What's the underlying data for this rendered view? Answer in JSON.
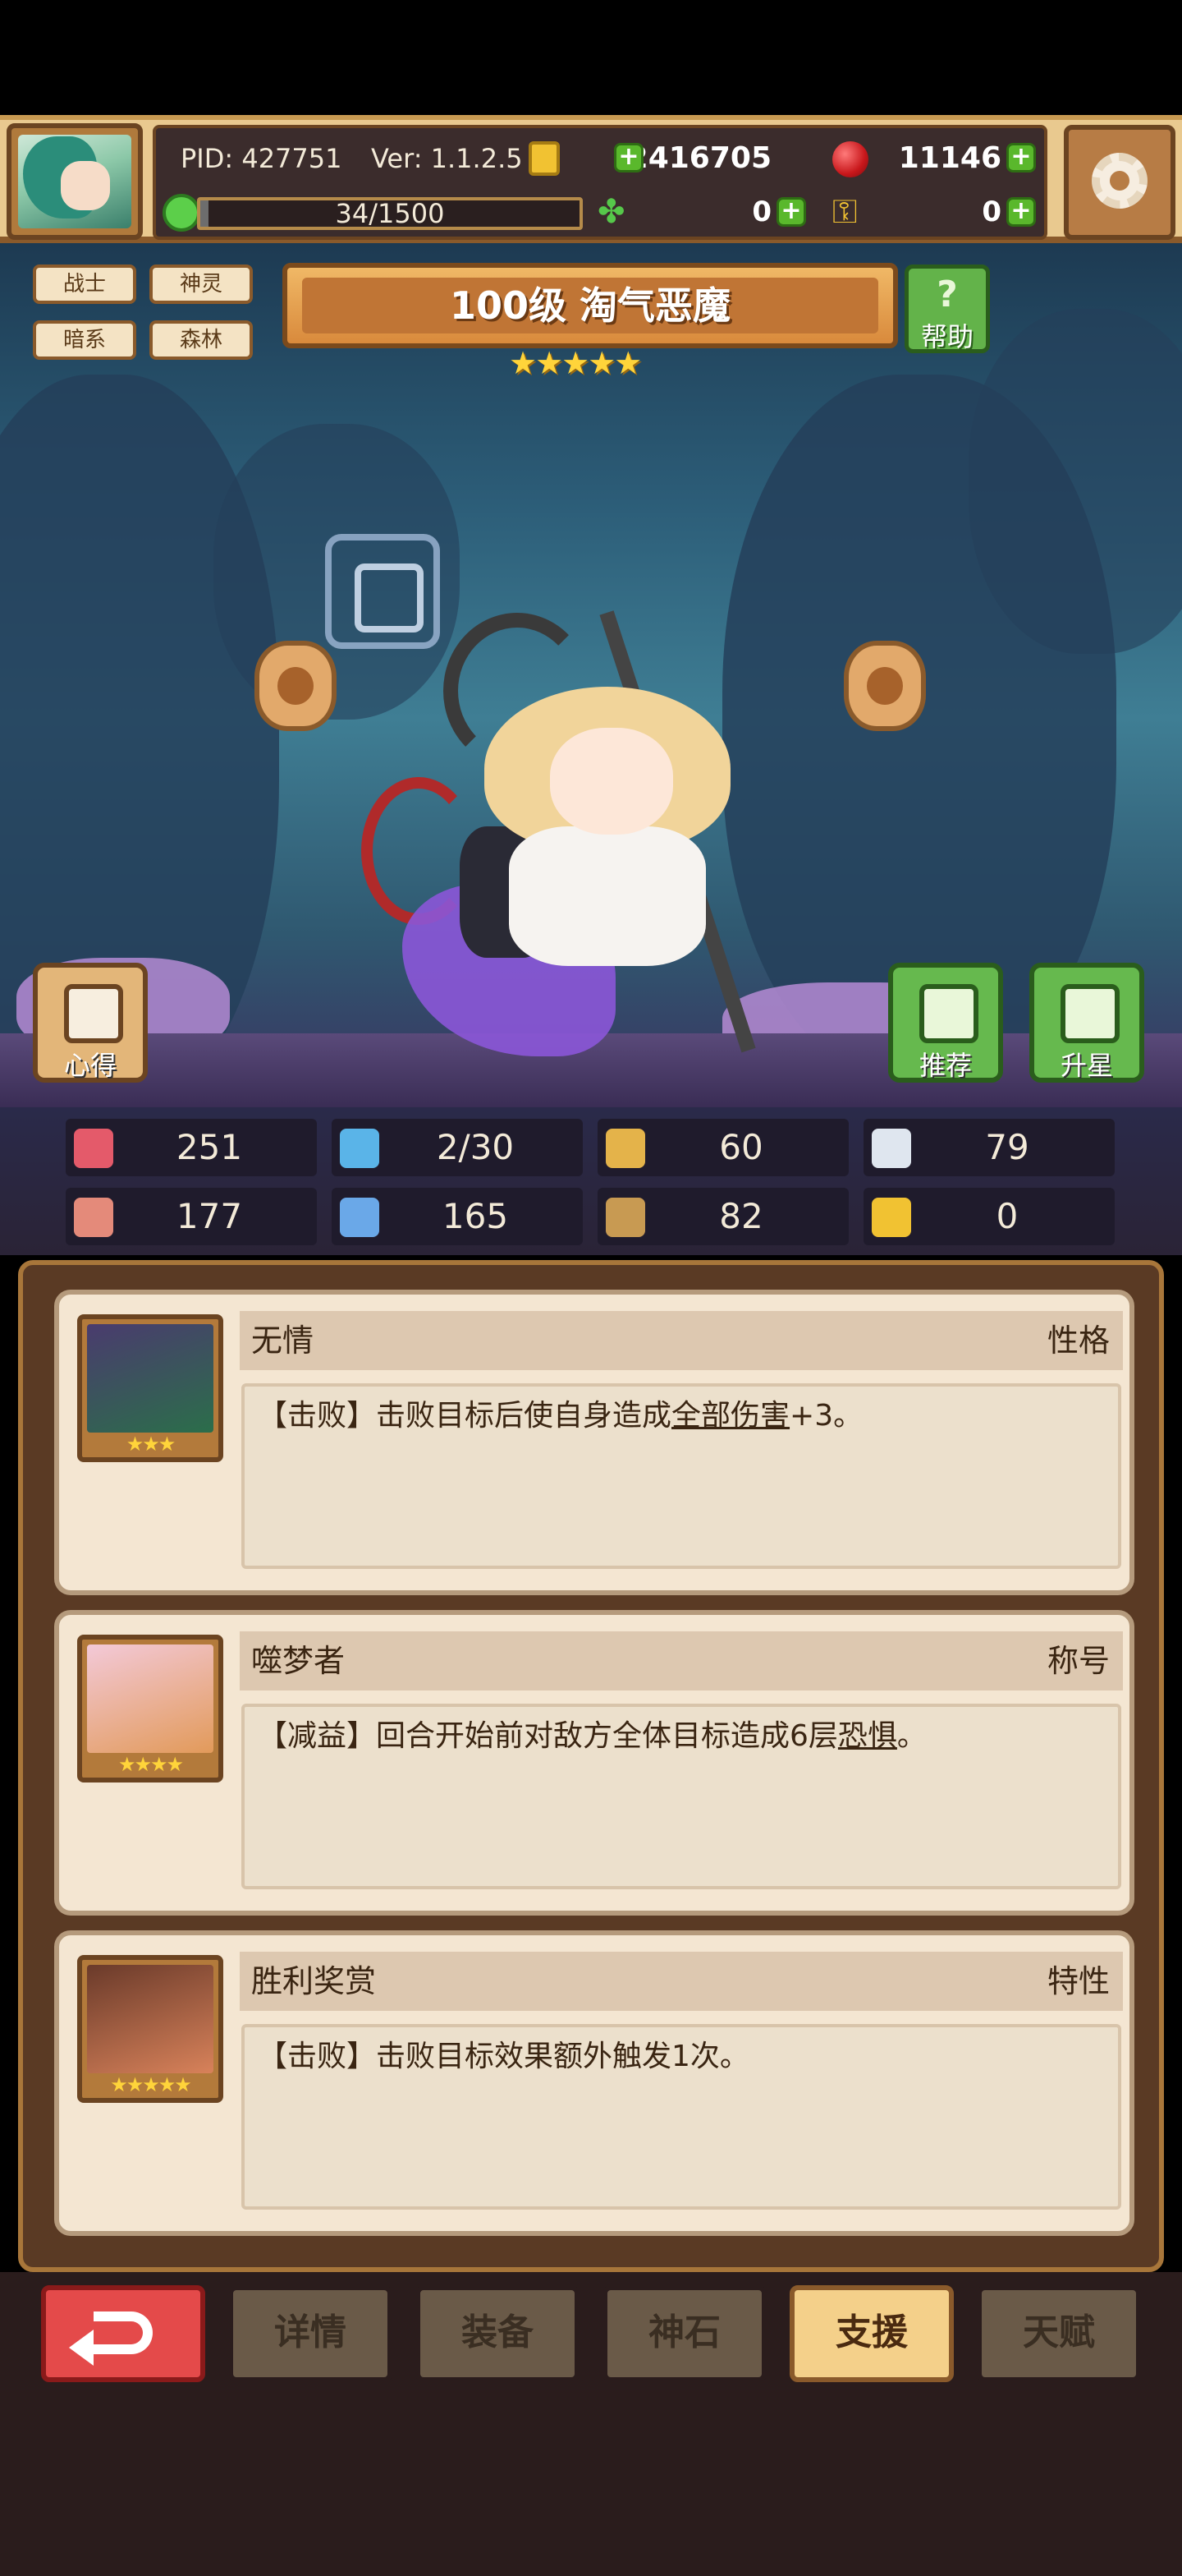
{
  "header": {
    "pid": "PID: 427751",
    "version": "Ver: 1.1.2.5",
    "gold": "2416705",
    "gems": "11146",
    "stamina": "34/1500",
    "stamina_fraction": 0.0227,
    "clover": "0",
    "keys": "0"
  },
  "tags": [
    "战士",
    "神灵",
    "暗系",
    "森林"
  ],
  "hero": {
    "title": "100级  淘气恶魔",
    "stars": "★★★★★",
    "help_label": "帮助"
  },
  "side_buttons": {
    "notes": "心得",
    "recommend": "推荐",
    "star_up": "升星"
  },
  "stats": {
    "hp": "251",
    "mana": "2/30",
    "defense": "60",
    "speed": "79",
    "attack": "177",
    "magic": "165",
    "armor": "82",
    "luck": "0"
  },
  "support_cards": [
    {
      "name": "无情",
      "type": "性格",
      "stars": "★★★",
      "desc_pre": "【击败】击败目标后使自身造成",
      "desc_link": "全部伤害",
      "desc_post": "+3。"
    },
    {
      "name": "噬梦者",
      "type": "称号",
      "stars": "★★★★",
      "desc_pre": "【减益】回合开始前对敌方全体目标造成6层",
      "desc_link": "恐惧",
      "desc_post": "。"
    },
    {
      "name": "胜利奖赏",
      "type": "特性",
      "stars": "★★★★★",
      "desc_pre": "【击败】击败目标效果额外触发1次。",
      "desc_link": "",
      "desc_post": ""
    }
  ],
  "nav": {
    "details": "详情",
    "equipment": "装备",
    "godstone": "神石",
    "support": "支援",
    "talent": "天赋"
  },
  "colors": {
    "gold_accent": "#f1c232",
    "green_button": "#66b94e",
    "red_back": "#e44a4a",
    "active_tab": "#f4d08a"
  }
}
